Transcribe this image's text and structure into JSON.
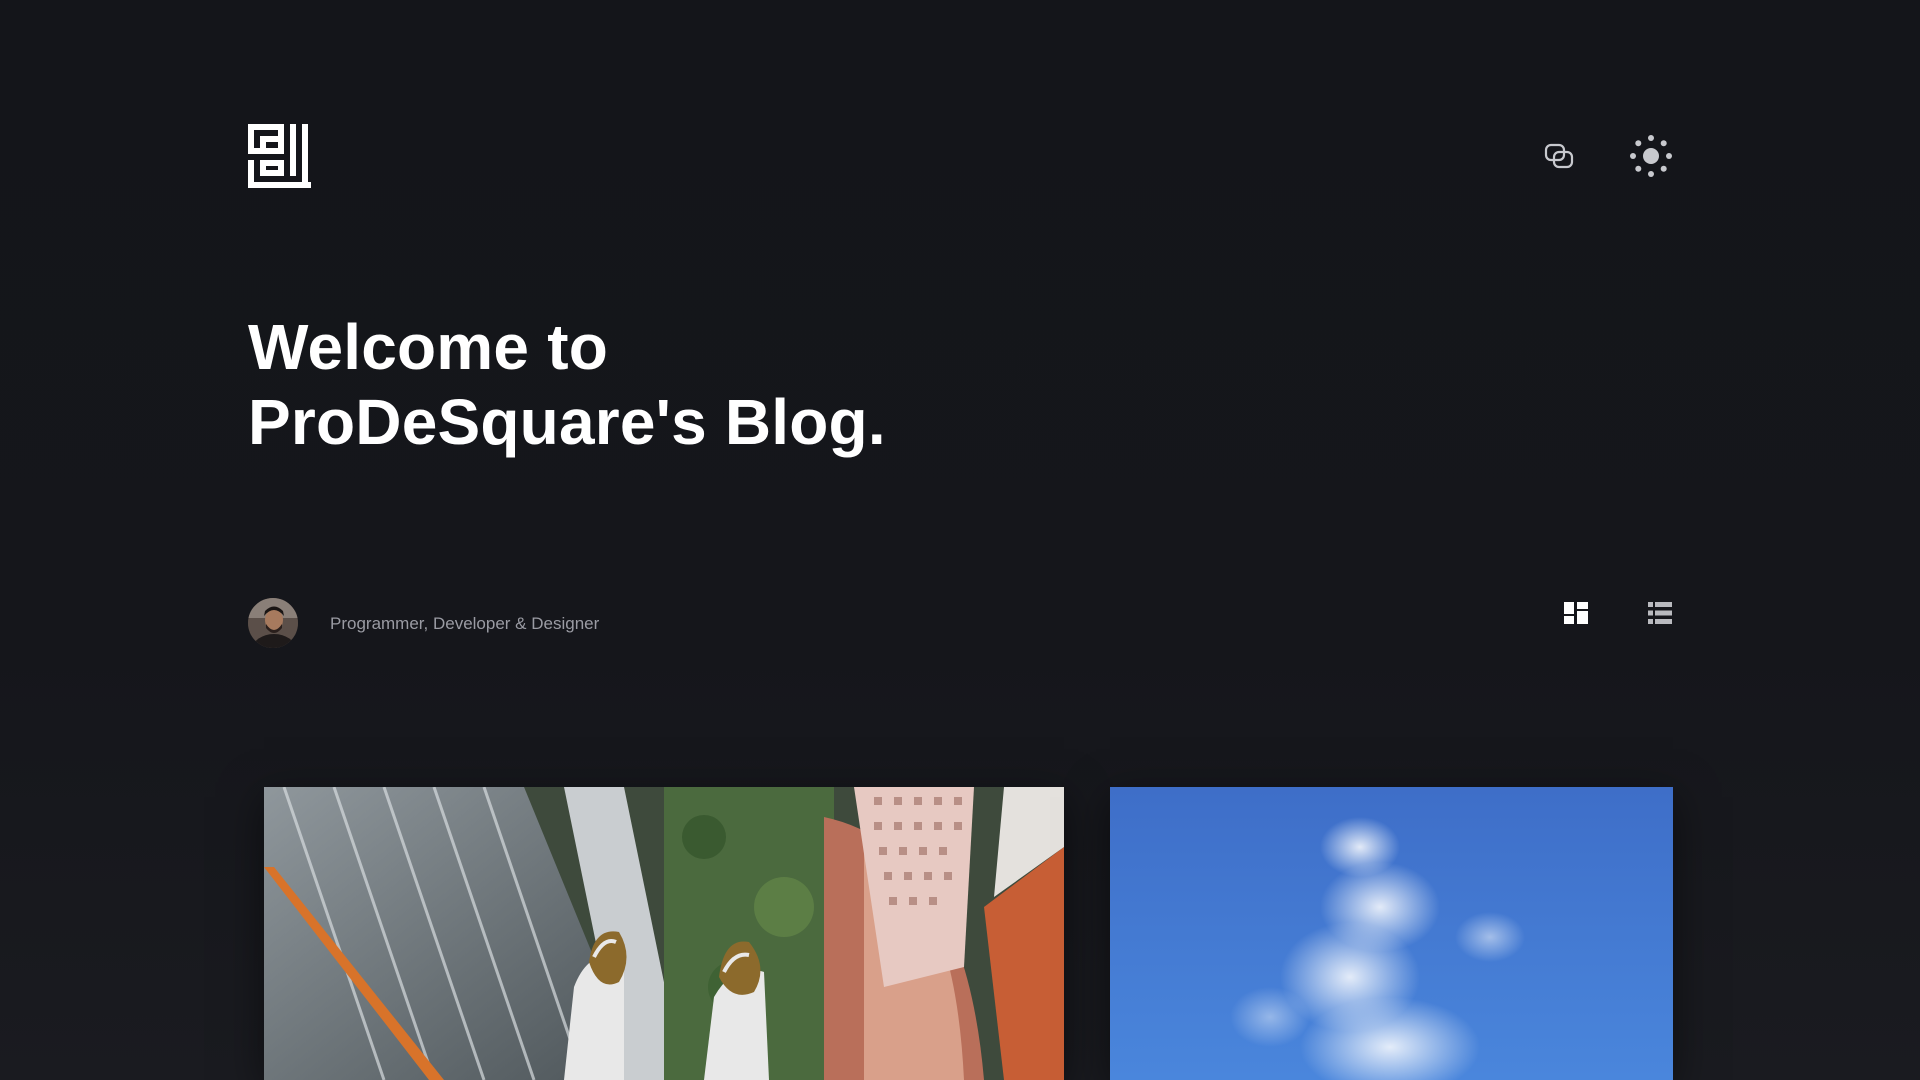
{
  "header": {
    "logo_alt": "ProDeSquare logo",
    "chat_icon": "chat-bubbles-icon",
    "theme_icon": "sun-icon"
  },
  "hero": {
    "line1": "Welcome to",
    "line2": "ProDeSquare's Blog."
  },
  "author": {
    "avatar_icon": "author-avatar",
    "tagline": "Programmer, Developer & Designer"
  },
  "view_toggle": {
    "grid_icon": "grid-view-icon",
    "list_icon": "list-view-icon"
  },
  "posts": [
    {
      "image": "city-rooftop-feet-photo"
    },
    {
      "image": "blue-sky-clouds-photo"
    }
  ],
  "colors": {
    "background": "#15161b",
    "text": "#ffffff",
    "muted_text": "#9a9ba3",
    "icon_gray": "#c8c9ce"
  }
}
